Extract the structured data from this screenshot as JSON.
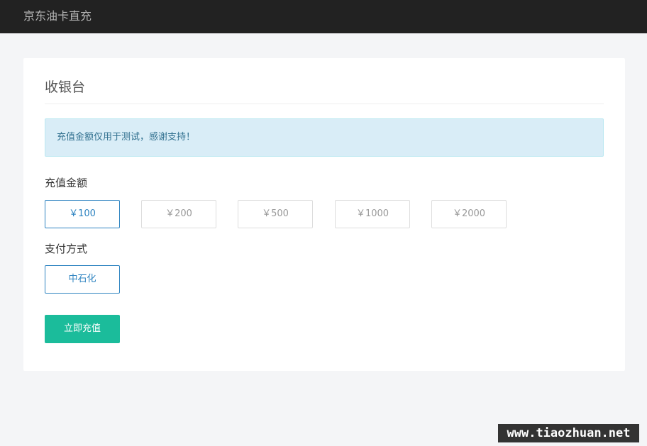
{
  "header": {
    "brand": "京东油卡直充"
  },
  "cashier": {
    "title": "收银台",
    "notice": "充值金额仅用于测试，感谢支持！",
    "amount_label": "充值金额",
    "amounts": [
      {
        "label": "￥100",
        "selected": true
      },
      {
        "label": "￥200",
        "selected": false
      },
      {
        "label": "￥500",
        "selected": false
      },
      {
        "label": "￥1000",
        "selected": false
      },
      {
        "label": "￥2000",
        "selected": false
      }
    ],
    "payment_label": "支付方式",
    "payment_methods": [
      {
        "label": "中石化",
        "selected": true
      }
    ],
    "submit_label": "立即充值"
  },
  "watermark": "www.tiaozhuan.net",
  "colors": {
    "header_bg": "#222222",
    "accent": "#2f84c1",
    "submit_bg": "#1bbc9b",
    "notice_bg": "#d9edf7"
  }
}
